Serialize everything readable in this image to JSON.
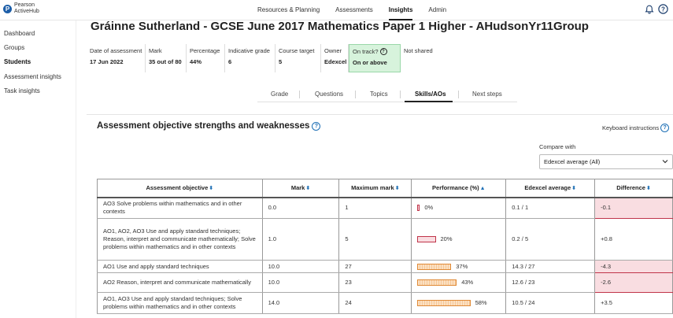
{
  "brand": {
    "line1": "Pearson",
    "line2": "ActiveHub"
  },
  "nav": {
    "items": [
      {
        "label": "Resources & Planning",
        "active": false
      },
      {
        "label": "Assessments",
        "active": false
      },
      {
        "label": "Insights",
        "active": true
      },
      {
        "label": "Admin",
        "active": false
      }
    ],
    "icons": [
      "bell-icon",
      "help-icon"
    ]
  },
  "sidebar": {
    "items": [
      {
        "label": "Dashboard",
        "active": false
      },
      {
        "label": "Groups",
        "active": false
      },
      {
        "label": "Students",
        "active": true
      },
      {
        "label": "Assessment insights",
        "active": false
      },
      {
        "label": "Task insights",
        "active": false
      }
    ]
  },
  "page": {
    "title": "Gráinne Sutherland - GCSE June 2017 Mathematics Paper 1 Higher - AHudsonYr11Group"
  },
  "summary": [
    {
      "label": "Date of assessment",
      "value": "17 Jun 2022"
    },
    {
      "label": "Mark",
      "value": "35 out of 80"
    },
    {
      "label": "Percentage",
      "value": "44%"
    },
    {
      "label": "Indicative grade",
      "value": "6"
    },
    {
      "label": "Course target",
      "value": "5"
    },
    {
      "label": "Owner",
      "value": "Edexcel"
    },
    {
      "label": "On track?",
      "value": "On or above",
      "highlight": "#d7f3dc"
    },
    {
      "label": "Not shared",
      "value": ""
    }
  ],
  "tabs": [
    {
      "label": "Grade",
      "active": false
    },
    {
      "label": "Questions",
      "active": false
    },
    {
      "label": "Topics",
      "active": false
    },
    {
      "label": "Skills/AOs",
      "active": true
    },
    {
      "label": "Next steps",
      "active": false
    }
  ],
  "section": {
    "title": "Assessment objective strengths and weaknesses",
    "keyboard_instructions": "Keyboard instructions",
    "compare_label": "Compare with",
    "compare_value": "Edexcel average (All)"
  },
  "table": {
    "headers": [
      "Assessment objective",
      "Mark",
      "Maximum mark",
      "Performance (%)",
      "Edexcel average",
      "Difference"
    ],
    "rows": [
      {
        "objective": "AO3 Solve problems within mathematics and in other contexts",
        "mark": "0.0",
        "max": "1",
        "performance": "0%",
        "perf_value": 0,
        "perf_status": "weak",
        "average": "0.1 / 1",
        "difference": "-0.1",
        "negative": true
      },
      {
        "objective": "AO1, AO2, AO3 Use and apply standard techniques; Reason, interpret and communicate mathematically; Solve problems within mathematics and in other contexts",
        "mark": "1.0",
        "max": "5",
        "performance": "20%",
        "perf_value": 20,
        "perf_status": "weak",
        "average": "0.2 / 5",
        "difference": "+0.8",
        "negative": false
      },
      {
        "objective": "AO1 Use and apply standard techniques",
        "mark": "10.0",
        "max": "27",
        "performance": "37%",
        "perf_value": 37,
        "perf_status": "medium",
        "average": "14.3 / 27",
        "difference": "-4.3",
        "negative": true
      },
      {
        "objective": "AO2 Reason, interpret and communicate mathematically",
        "mark": "10.0",
        "max": "23",
        "performance": "43%",
        "perf_value": 43,
        "perf_status": "medium",
        "average": "12.6 / 23",
        "difference": "-2.6",
        "negative": true
      },
      {
        "objective": "AO1, AO3 Use and apply standard techniques; Solve problems within mathematics and in other contexts",
        "mark": "14.0",
        "max": "24",
        "performance": "58%",
        "perf_value": 58,
        "perf_status": "medium",
        "average": "10.5 / 24",
        "difference": "+3.5",
        "negative": false
      }
    ]
  },
  "colors": {
    "accent": "#1d6fb5",
    "weak": "#c0344a",
    "medium": "#e08a36",
    "negative_bg": "#f9dde1",
    "on_track_bg": "#d7f3dc"
  }
}
